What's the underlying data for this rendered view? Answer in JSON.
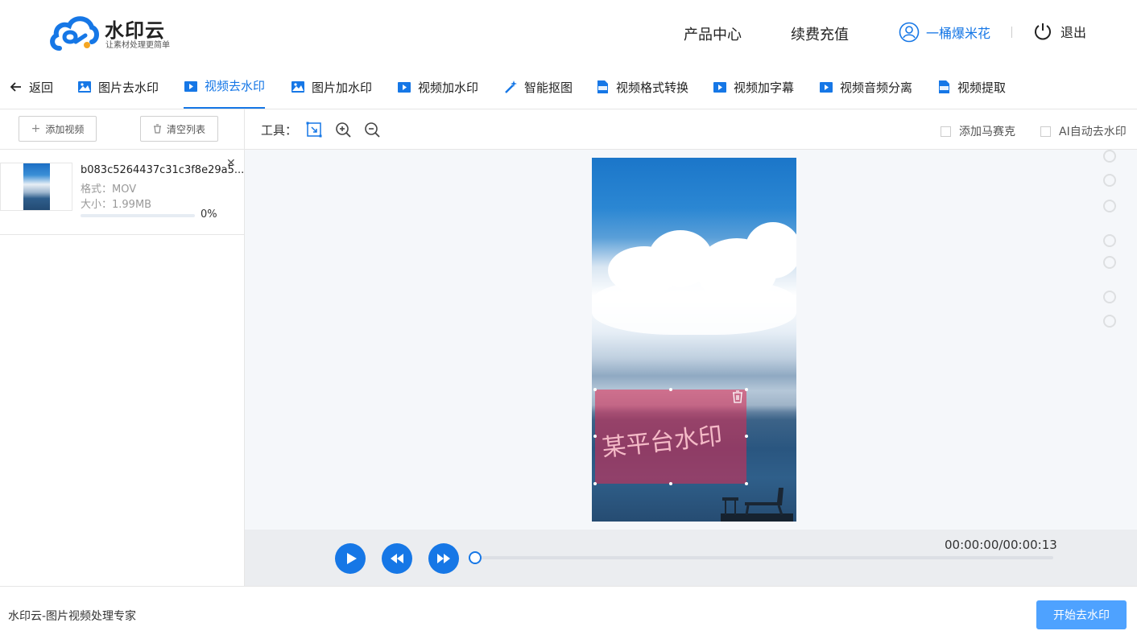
{
  "brand": {
    "title": "水印云",
    "slogan": "让素材处理更简单"
  },
  "header": {
    "nav": [
      "产品中心",
      "续费充值"
    ],
    "username": "一桶爆米花",
    "logout": "退出"
  },
  "tabs": {
    "back": "返回",
    "items": [
      {
        "label": "图片去水印",
        "icon": "image-icon"
      },
      {
        "label": "视频去水印",
        "icon": "video-icon",
        "active": true
      },
      {
        "label": "图片加水印",
        "icon": "image-icon"
      },
      {
        "label": "视频加水印",
        "icon": "video-icon"
      },
      {
        "label": "智能抠图",
        "icon": "magic-wand-icon"
      },
      {
        "label": "视频格式转换",
        "icon": "mp4-icon"
      },
      {
        "label": "视频加字幕",
        "icon": "video-icon"
      },
      {
        "label": "视频音频分离",
        "icon": "video-icon"
      },
      {
        "label": "视频提取",
        "icon": "mp4-icon"
      }
    ]
  },
  "left_panel": {
    "add_button": "添加视频",
    "clear_button": "清空列表",
    "file": {
      "name": "b083c5264437c31c3f8e29a5...",
      "format": "格式：MOV",
      "size": "大小：1.99MB",
      "progress": 0,
      "progress_text": "0%"
    }
  },
  "toolbar": {
    "label": "工具：",
    "mosaic": "添加马赛克",
    "ai_remove": "AI自动去水印"
  },
  "canvas": {
    "watermark_text": "某平台水印"
  },
  "player": {
    "time": "00:00:00/00:00:13",
    "progress": 0
  },
  "footer": {
    "text": "水印云-图片视频处理专家",
    "start_button": "开始去水印"
  },
  "colors": {
    "accent": "#1677e6",
    "start_button": "#4ea2ff",
    "selection": "#e12850"
  }
}
